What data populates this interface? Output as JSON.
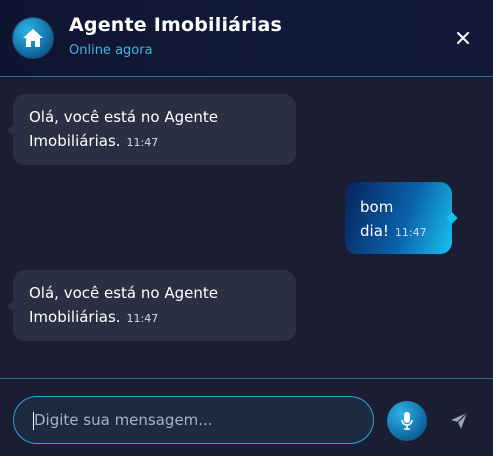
{
  "header": {
    "title": "Agente Imobiliárias",
    "status": "Online agora",
    "avatar_icon": "home-icon",
    "close_icon": "close-icon"
  },
  "messages": [
    {
      "sender": "bot",
      "lines": [
        "Olá, você está no Agente",
        "Imobiliárias."
      ],
      "time": "11:47"
    },
    {
      "sender": "user",
      "lines": [
        "bom",
        "dia!"
      ],
      "time": "11:47"
    },
    {
      "sender": "bot",
      "lines": [
        "Olá, você está no Agente",
        "Imobiliárias."
      ],
      "time": "11:47"
    }
  ],
  "composer": {
    "placeholder": "Digite sua mensagem...",
    "value": "",
    "mic_icon": "microphone-icon",
    "send_icon": "send-icon"
  },
  "colors": {
    "accent": "#2aa6d6",
    "status_text": "#3fb6e8",
    "bot_bubble": "#2a2f44",
    "background": "#1b1e33"
  }
}
